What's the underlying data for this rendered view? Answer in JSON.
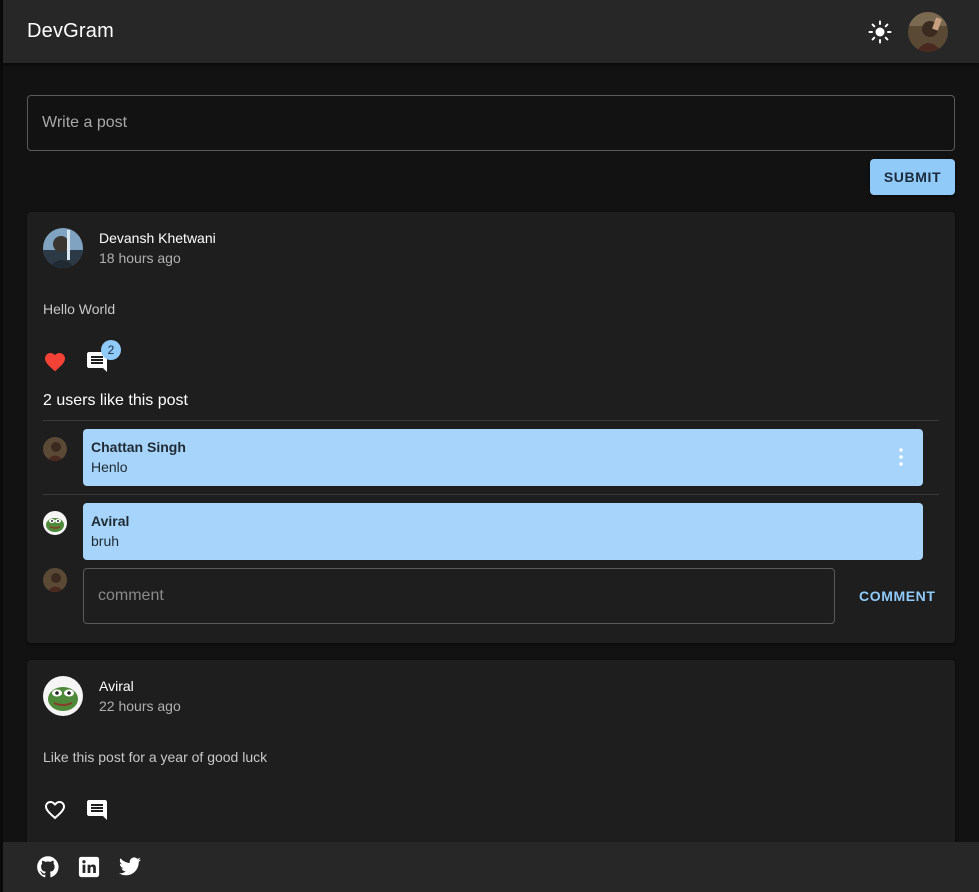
{
  "app": {
    "title": "DevGram"
  },
  "header": {
    "theme_toggle_icon": "sun-icon",
    "profile_avatar_icon": "user-avatar"
  },
  "composer": {
    "placeholder": "Write a post",
    "submit_label": "SUBMIT"
  },
  "posts": [
    {
      "author": "Devansh Khetwani",
      "time": "18 hours ago",
      "text": "Hello World",
      "liked": true,
      "comment_count": "2",
      "likes_text": "2 users like this post",
      "comments": [
        {
          "author": "Chattan Singh",
          "text": "Henlo"
        },
        {
          "author": "Aviral",
          "text": "bruh"
        }
      ],
      "comment_placeholder": "comment",
      "comment_button": "COMMENT"
    },
    {
      "author": "Aviral",
      "time": "22 hours ago",
      "text": "Like this post for a year of good luck",
      "liked": false
    }
  ],
  "footer": {
    "links": [
      "github-icon",
      "linkedin-icon",
      "twitter-icon"
    ]
  },
  "colors": {
    "accent": "#90caf9",
    "comment_bg": "#a6d4fa",
    "like": "#f44336",
    "card": "#1e1e1e",
    "appbar": "#272727"
  }
}
